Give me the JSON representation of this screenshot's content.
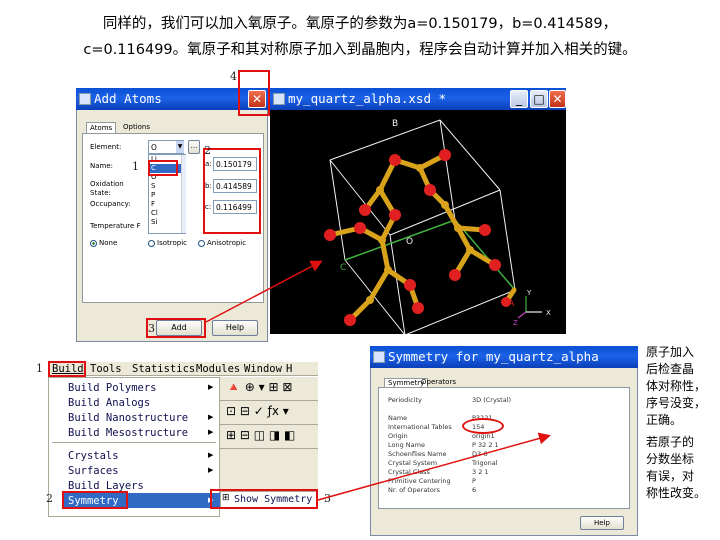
{
  "header": {
    "line1": "同样的，我们可以加入氧原子。氧原子的参数为a=0.150179，b=0.414589，",
    "line2": "c=0.116499。氧原子和其对称原子加入到晶胞内，程序会自动计算并加入相关的键。"
  },
  "add_atoms": {
    "title": "Add Atoms",
    "tabs": [
      "Atoms",
      "Options"
    ],
    "element_label": "Element:",
    "element_value": "O",
    "name_label": "Name:",
    "oxidation_label": "Oxidation State:",
    "occupancy_label": "Occupancy:",
    "temperature_label": "Temperature F",
    "element_list": [
      "Li",
      "C",
      "O",
      "S",
      "P",
      "F",
      "Cl",
      "Si"
    ],
    "a_label": "a:",
    "b_label": "b:",
    "c_label": "c:",
    "a_value": "0.150179",
    "b_value": "0.414589",
    "c_value": "0.116499",
    "radio_none": "None",
    "radio_isotropic": "Isotropic",
    "radio_anisotropic": "Anisotropic",
    "add_button": "Add",
    "help_button": "Help"
  },
  "viewer": {
    "title": "my_quartz_alpha.xsd *",
    "axis_b": "B",
    "axis_a": "A",
    "axis_c": "C",
    "axis_o": "O",
    "coord_y": "Y",
    "coord_x": "X",
    "coord_z": "Z"
  },
  "build_menu": {
    "menubar": [
      "Build",
      "Tools",
      "Statistics",
      "Modules",
      "Window",
      "H"
    ],
    "items": [
      "Build Polymers",
      "Build Analogs",
      "Build Nanostructure",
      "Build Mesostructure",
      "Crystals",
      "Surfaces",
      "Build Layers",
      "Symmetry"
    ],
    "show_symmetry": "Show Symmetry"
  },
  "symmetry": {
    "title": "Symmetry for my_quartz_alpha",
    "tabs": [
      "Symmetry",
      "Operators"
    ],
    "rows": [
      {
        "label": "Periodicity",
        "value": "3D (Crystal)"
      },
      {
        "label": "Name",
        "value": "P3221"
      },
      {
        "label": "International Tables",
        "value": "154"
      },
      {
        "label": "Origin",
        "value": "origin1"
      },
      {
        "label": "Long Name",
        "value": "P 32 2 1"
      },
      {
        "label": "Schoenflies Name",
        "value": "D3-6"
      },
      {
        "label": "Crystal System",
        "value": "Trigonal"
      },
      {
        "label": "Crystal Class",
        "value": "3 2 1"
      },
      {
        "label": "Primitive Centering",
        "value": "P"
      },
      {
        "label": "Nr. of Operators",
        "value": "6"
      }
    ],
    "help_button": "Help"
  },
  "side_notes": {
    "note1": "原子加入\n后检查晶\n体对称性，\n序号没变，\n正确。",
    "note2": "若原子的\n分数坐标\n有误，对\n称性改变。"
  },
  "markers": {
    "m1": "1",
    "m2": "2",
    "m3": "3",
    "m4": "4",
    "b1": "1",
    "b2": "2",
    "b3": "3"
  },
  "colors": {
    "highlight": "#e01010",
    "titlebar": "#1c62e8",
    "silicon": "#d9a21b",
    "oxygen": "#e02020"
  }
}
